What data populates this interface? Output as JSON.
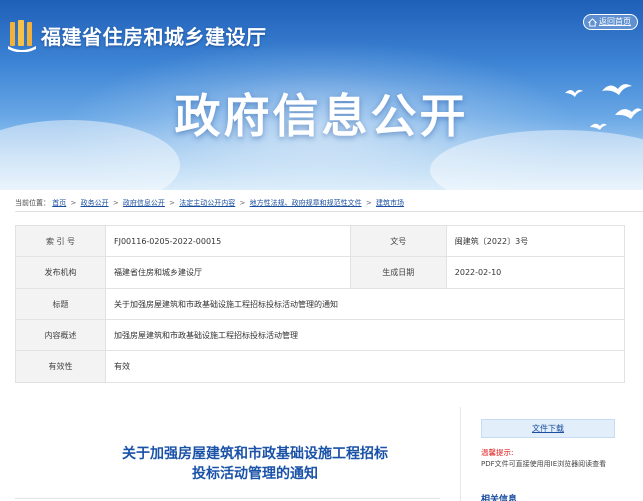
{
  "header": {
    "site_name": "福建省住房和城乡建设厅",
    "back_home": "返回首页",
    "banner_title": "政府信息公开"
  },
  "breadcrumb": {
    "prefix": "当前位置：",
    "items": [
      "首页",
      "政务公开",
      "政府信息公开",
      "法定主动公开内容",
      "地方性法规、政府规章和规范性文件",
      "建筑市场"
    ],
    "separator": ">"
  },
  "info": {
    "index_label": "索 引 号",
    "index_value": "FJ00116-0205-2022-00015",
    "doc_no_label": "文号",
    "doc_no_value": "闽建筑〔2022〕3号",
    "publisher_label": "发布机构",
    "publisher_value": "福建省住房和城乡建设厅",
    "date_label": "生成日期",
    "date_value": "2022-02-10",
    "title_label": "标题",
    "title_value": "关于加强房屋建筑和市政基础设施工程招标投标活动管理的通知",
    "summary_label": "内容概述",
    "summary_value": "加强房屋建筑和市政基础设施工程招标投标活动管理",
    "validity_label": "有效性",
    "validity_value": "有效"
  },
  "article": {
    "title_line1": "关于加强房屋建筑和市政基础设施工程招标",
    "title_line2": "投标活动管理的通知"
  },
  "sidebar": {
    "download_label": "文件下载",
    "tip_label": "温馨提示:",
    "tip_text": "PDF文件可直接使用用IE浏览器阅读查看",
    "related_label": "相关信息"
  },
  "colors": {
    "brand_blue": "#1a52a8",
    "banner_top": "#1f5fb8",
    "tip_red": "#e02020"
  }
}
